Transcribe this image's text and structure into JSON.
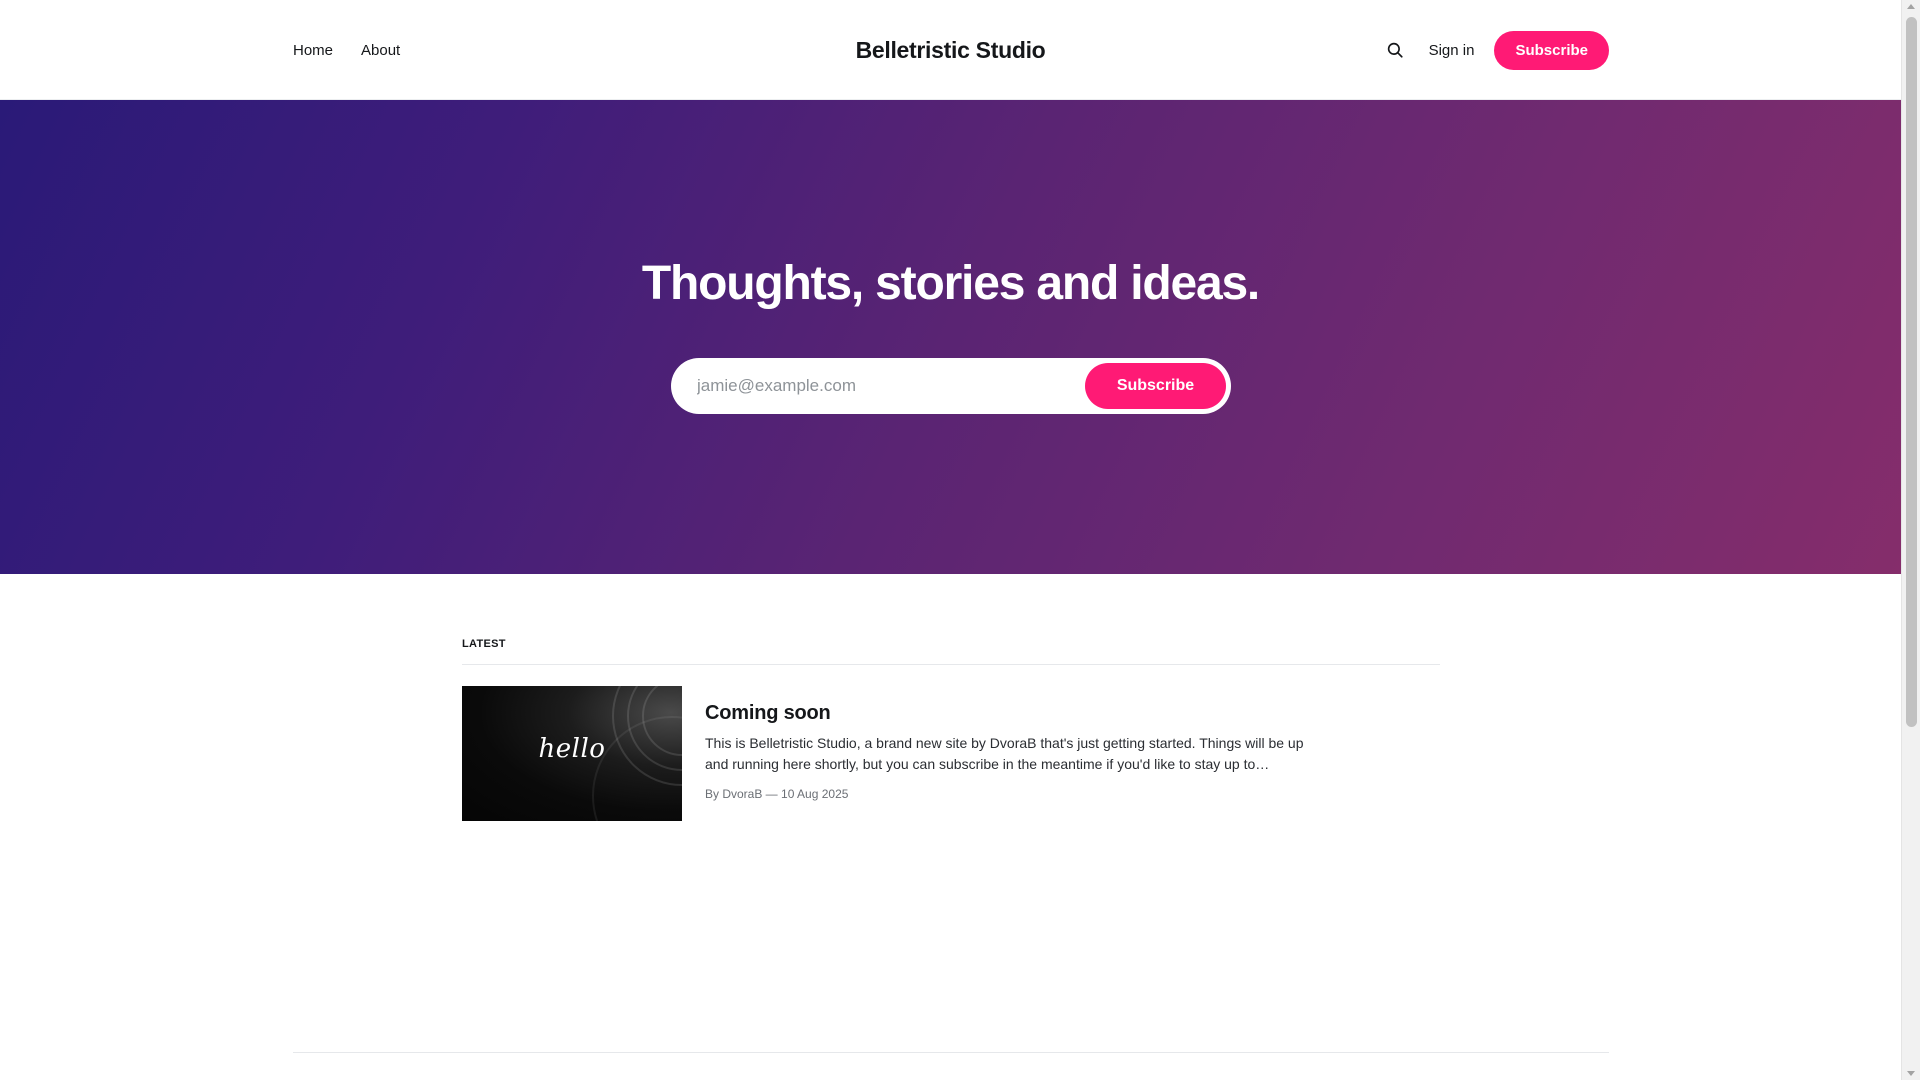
{
  "header": {
    "nav": [
      {
        "label": "Home"
      },
      {
        "label": "About"
      }
    ],
    "site_title": "Belletristic Studio",
    "search_icon": "search-icon",
    "signin_label": "Sign in",
    "subscribe_label": "Subscribe"
  },
  "hero": {
    "title": "Thoughts, stories and ideas.",
    "email_placeholder": "jamie@example.com",
    "subscribe_label": "Subscribe"
  },
  "latest": {
    "label": "LATEST",
    "posts": [
      {
        "title": "Coming soon",
        "excerpt": "This is Belletristic Studio, a brand new site by DvoraB that's just getting started. Things will be up and running here shortly, but you can subscribe in the meantime if you'd like to stay up to…",
        "meta": "By DvoraB — 10 Aug 2025",
        "image_text": "hello"
      }
    ]
  },
  "colors": {
    "accent": "#ff1a75",
    "hero_gradient_start": "#2a1a78",
    "hero_gradient_end": "#852d6b",
    "text": "#15171a"
  }
}
